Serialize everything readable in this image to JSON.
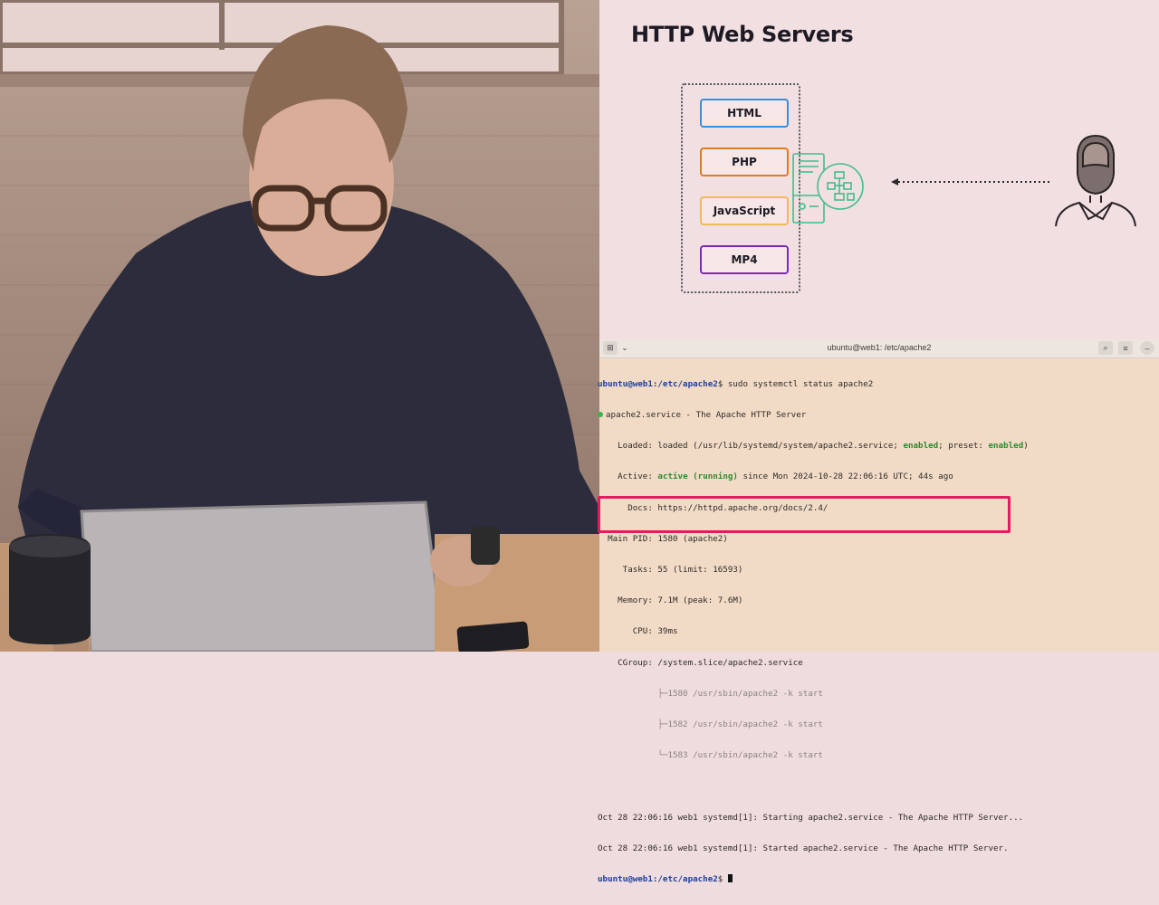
{
  "slide": {
    "title": "HTTP Web Servers",
    "files": [
      {
        "label": "HTML",
        "color": "#3a8fd8"
      },
      {
        "label": "PHP",
        "color": "#dd7d22"
      },
      {
        "label": "JavaScript",
        "color": "#f0b85c"
      },
      {
        "label": "MP4",
        "color": "#7a2bbf"
      }
    ],
    "server_color": "#3fbf8a"
  },
  "terminal": {
    "title": "ubuntu@web1: /etc/apache2",
    "prompt_user": "ubuntu@web1",
    "prompt_path": ":/etc/apache2",
    "command": "$ sudo systemctl status apache2",
    "service_line": "apache2.service - The Apache HTTP Server",
    "loaded": {
      "label": "    Loaded:",
      "pre": " loaded (/usr/lib/systemd/system/apache2.service; ",
      "enabled1": "enabled",
      "mid": "; preset: ",
      "enabled2": "enabled",
      "post": ")"
    },
    "active": {
      "label": "    Active:",
      "state": "active (running)",
      "since": " since Mon 2024-10-28 22:06:16 UTC; 44s ago"
    },
    "docs": "      Docs: https://httpd.apache.org/docs/2.4/",
    "main_pid": "  Main PID: 1580 (apache2)",
    "tasks": "     Tasks: 55 (limit: 16593)",
    "memory": "    Memory: 7.1M (peak: 7.6M)",
    "cpu": "       CPU: 39ms",
    "cgroup": "    CGroup: /system.slice/apache2.service",
    "procs": [
      "            ├─1580 /usr/sbin/apache2 -k start",
      "            ├─1582 /usr/sbin/apache2 -k start",
      "            └─1583 /usr/sbin/apache2 -k start"
    ],
    "log": [
      "Oct 28 22:06:16 web1 systemd[1]: Starting apache2.service - The Apache HTTP Server...",
      "Oct 28 22:06:16 web1 systemd[1]: Started apache2.service - The Apache HTTP Server."
    ],
    "final_prompt_user": "ubuntu@web1",
    "final_prompt_path": ":/etc/apache2",
    "final_prompt_end": "$ ",
    "highlight_color": "#e8195e"
  }
}
